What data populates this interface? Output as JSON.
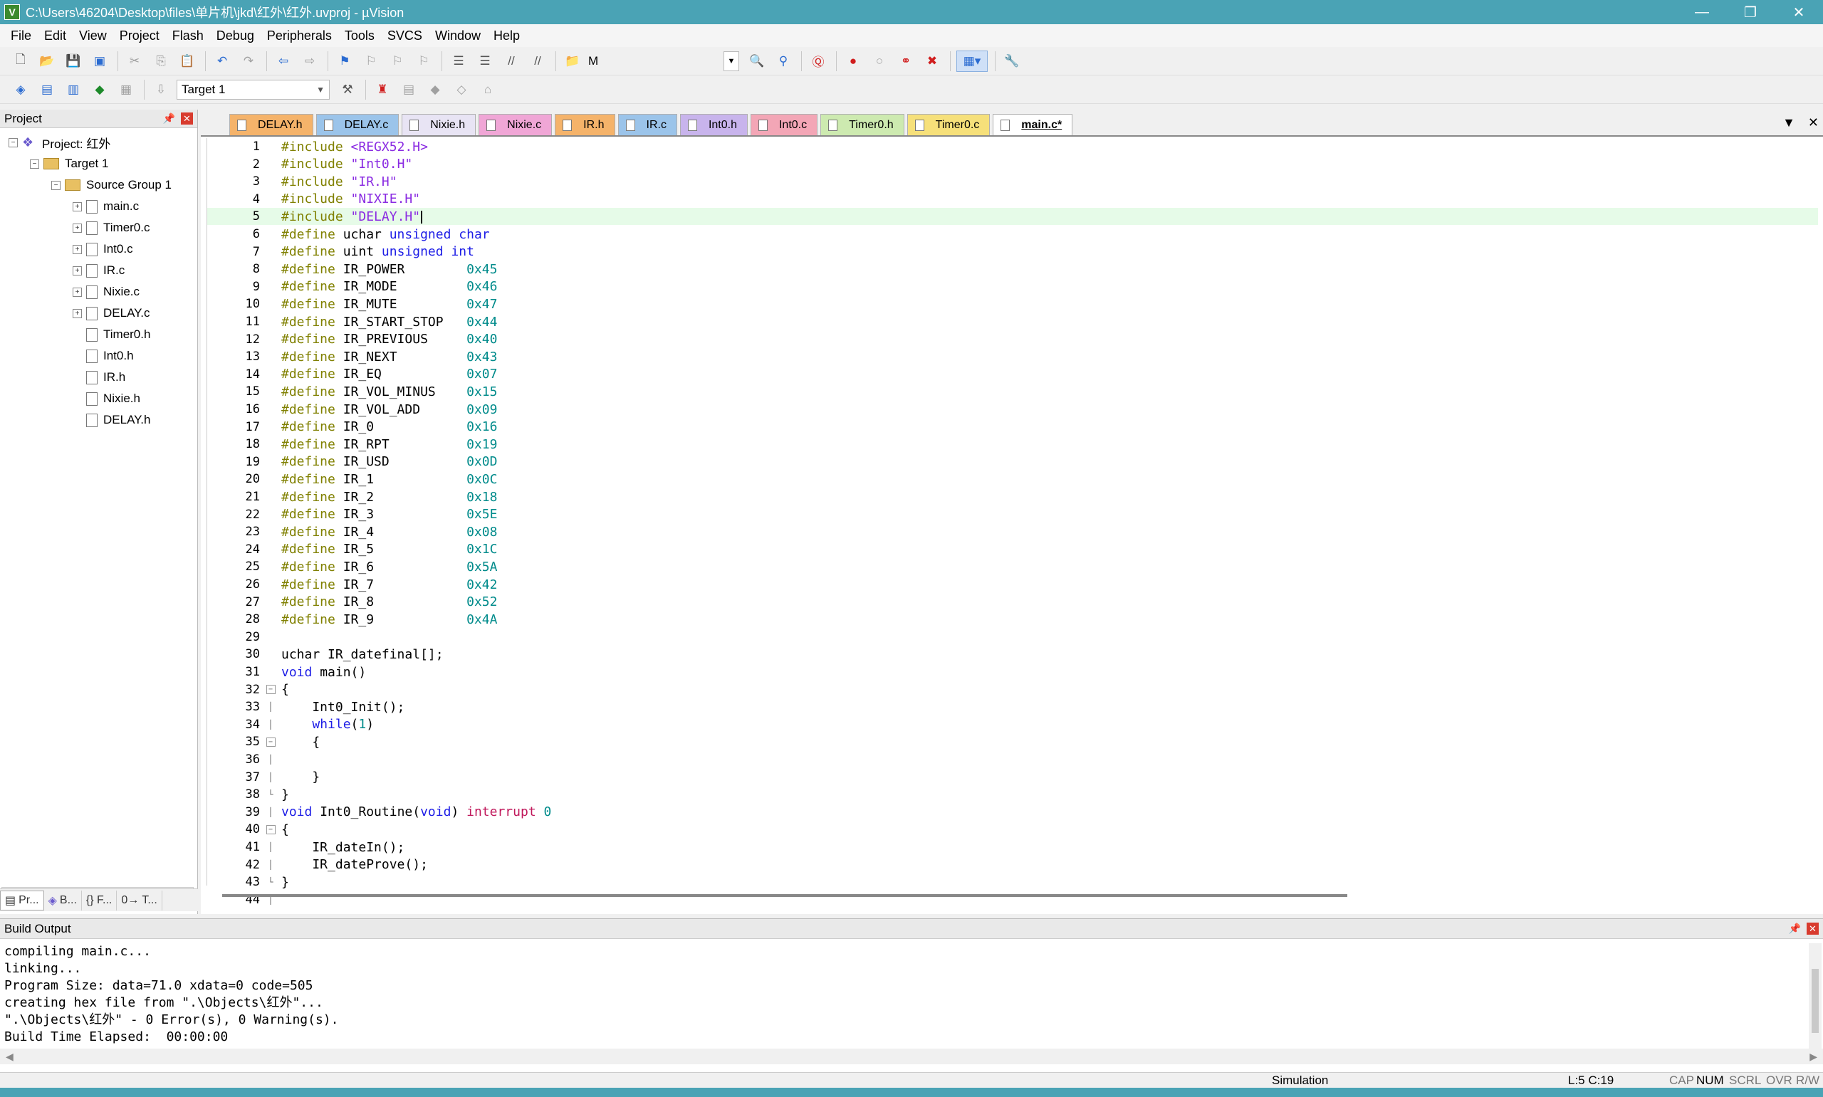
{
  "window": {
    "title": "C:\\Users\\46204\\Desktop\\files\\单片机\\jkd\\红外\\红外.uvproj - µVision",
    "minimize": "—",
    "restore": "❐",
    "close": "✕"
  },
  "menu": [
    "File",
    "Edit",
    "View",
    "Project",
    "Flash",
    "Debug",
    "Peripherals",
    "Tools",
    "SVCS",
    "Window",
    "Help"
  ],
  "toolbar": {
    "find_text": "M",
    "target": "Target 1"
  },
  "project_panel": {
    "title": "Project",
    "root": "Project: 红外",
    "target": "Target 1",
    "group": "Source Group 1",
    "files": [
      "main.c",
      "Timer0.c",
      "Int0.c",
      "IR.c",
      "Nixie.c",
      "DELAY.c",
      "Timer0.h",
      "Int0.h",
      "IR.h",
      "Nixie.h",
      "DELAY.h"
    ],
    "tabs": [
      "Pr...",
      "B...",
      "{} F...",
      "0→ T..."
    ]
  },
  "editor": {
    "tabs": [
      {
        "label": "DELAY.h",
        "color": "#f5b36a"
      },
      {
        "label": "DELAY.c",
        "color": "#9bc4ea"
      },
      {
        "label": "Nixie.h",
        "color": "#e8e4f4"
      },
      {
        "label": "Nixie.c",
        "color": "#f0a6d6"
      },
      {
        "label": "IR.h",
        "color": "#f5b36a"
      },
      {
        "label": "IR.c",
        "color": "#9bc4ea"
      },
      {
        "label": "Int0.h",
        "color": "#c8b4ec"
      },
      {
        "label": "Int0.c",
        "color": "#f3a6b6"
      },
      {
        "label": "Timer0.h",
        "color": "#cdeab0"
      },
      {
        "label": "Timer0.c",
        "color": "#f6e07a"
      },
      {
        "label": "main.c*",
        "color": "#ffffff"
      }
    ],
    "current_line": 5,
    "lines": [
      "#include <REGX52.H>",
      "#include \"Int0.H\"",
      "#include \"IR.H\"",
      "#include \"NIXIE.H\"",
      "#include \"DELAY.H\"",
      "#define uchar unsigned char",
      "#define uint unsigned int",
      "#define IR_POWER        0x45",
      "#define IR_MODE         0x46",
      "#define IR_MUTE         0x47",
      "#define IR_START_STOP   0x44",
      "#define IR_PREVIOUS     0x40",
      "#define IR_NEXT         0x43",
      "#define IR_EQ           0x07",
      "#define IR_VOL_MINUS    0x15",
      "#define IR_VOL_ADD      0x09",
      "#define IR_0            0x16",
      "#define IR_RPT          0x19",
      "#define IR_USD          0x0D",
      "#define IR_1            0x0C",
      "#define IR_2            0x18",
      "#define IR_3            0x5E",
      "#define IR_4            0x08",
      "#define IR_5            0x1C",
      "#define IR_6            0x5A",
      "#define IR_7            0x42",
      "#define IR_8            0x52",
      "#define IR_9            0x4A",
      "",
      "uchar IR_datefinal[];",
      "void main()",
      "{",
      "    Int0_Init();",
      "    while(1)",
      "    {",
      "",
      "    }",
      "}",
      "void Int0_Routine(void) interrupt 0",
      "{",
      "    IR_dateIn();",
      "    IR_dateProve();",
      "}",
      ""
    ]
  },
  "build_output": {
    "title": "Build Output",
    "lines": [
      "compiling main.c...",
      "linking...",
      "Program Size: data=71.0 xdata=0 code=505",
      "creating hex file from \".\\Objects\\红外\"...",
      "\".\\Objects\\红外\" - 0 Error(s), 0 Warning(s).",
      "Build Time Elapsed:  00:00:00"
    ]
  },
  "status": {
    "mode": "Simulation",
    "position": "L:5 C:19",
    "cap": "CAP",
    "num": "NUM",
    "scrl": "SCRL",
    "ovr": "OVR",
    "rw": "R/W"
  }
}
